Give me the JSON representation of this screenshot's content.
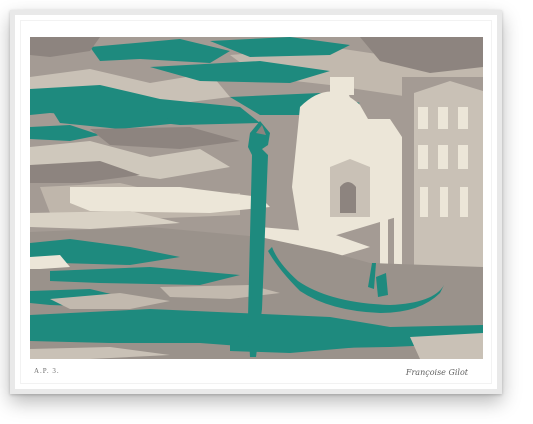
{
  "print": {
    "edition_mark": "A.P. 3.",
    "signature": "Françoise Gilot"
  },
  "palette": {
    "teal": "#1e8a7e",
    "taupe": "#a49b94",
    "cream": "#ece6d8",
    "dark_taupe": "#8d847f"
  }
}
